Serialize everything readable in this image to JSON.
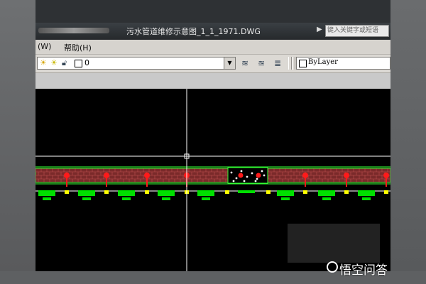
{
  "window": {
    "title": "污水管道维修示意图_1_1_1971.DWG",
    "search_placeholder": "键入关键字或短语"
  },
  "menu": {
    "items": [
      {
        "label": "(W)"
      },
      {
        "label": "帮助(H)"
      }
    ]
  },
  "toolbar": {
    "layer_name": "0",
    "layer_icons": [
      "sun-icon",
      "lightbulb-icon",
      "lock-icon",
      "color-swatch-icon"
    ],
    "buttons": [
      "layer-manager-icon",
      "layer-previous-icon",
      "layer-state-icon"
    ],
    "bylayer_label": "ByLayer"
  },
  "watermark": {
    "text": "悟空问答"
  },
  "colors": {
    "canvas_bg": "#000000",
    "crosshair": "#ffffff",
    "pipe_outline": "#33ff33",
    "brick_fill": "#7a2a2a",
    "valve_red": "#ff1a1a",
    "footing_green": "#00e000",
    "marker_yellow": "#ffff00"
  }
}
